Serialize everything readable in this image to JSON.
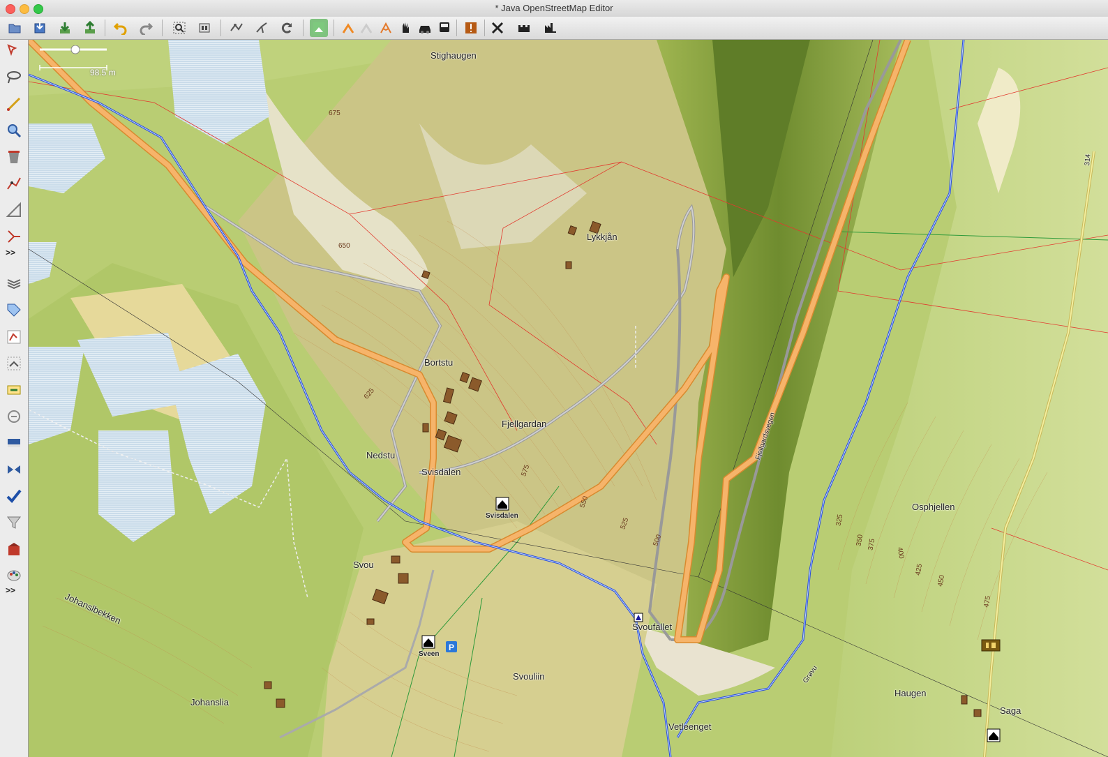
{
  "window": {
    "title": "* Java OpenStreetMap Editor"
  },
  "toolbar": {
    "buttons": [
      "open-file",
      "open-location",
      "download",
      "upload",
      "undo",
      "redo",
      "zoom-to-selection",
      "preferences",
      "wireframe",
      "combine-way",
      "refresh",
      "imagery-toggle",
      "mode-walk",
      "mode-bike",
      "mode-hike",
      "mode-hand",
      "mode-car",
      "mode-bus",
      "warning",
      "tools",
      "castle",
      "factory"
    ]
  },
  "sidebar": {
    "more_label_1": ">>",
    "more_label_2": ">>"
  },
  "map": {
    "scale_label": "98.5 m",
    "place_labels": {
      "stighaugen": "Stighaugen",
      "lykkjan": "Lykkjån",
      "bortstu": "Bortstu",
      "fjellgardan": "Fjellgardan",
      "nedstu": "Nedstu",
      "svisdalen": "Svisdalen",
      "svisdalen_poi": "Svisdalen",
      "svou": "Svou",
      "johanslbekken": "Johanslbekken",
      "sveen": "Sveen",
      "svouliin": "Svouliin",
      "johanslia": "Johanslia",
      "svoufallet": "Svoufallet",
      "vetleenget": "Vetleenget",
      "haugen": "Haugen",
      "saga": "Saga",
      "osphjellen": "Osphjellen",
      "fjellgardsvegen": "Fjellgardsvegen",
      "grovu": "Grøvu",
      "route": "314"
    },
    "contours": [
      "675",
      "650",
      "625",
      "575",
      "550",
      "525",
      "500",
      "325",
      "350",
      "375",
      "400",
      "425",
      "450",
      "475"
    ]
  }
}
